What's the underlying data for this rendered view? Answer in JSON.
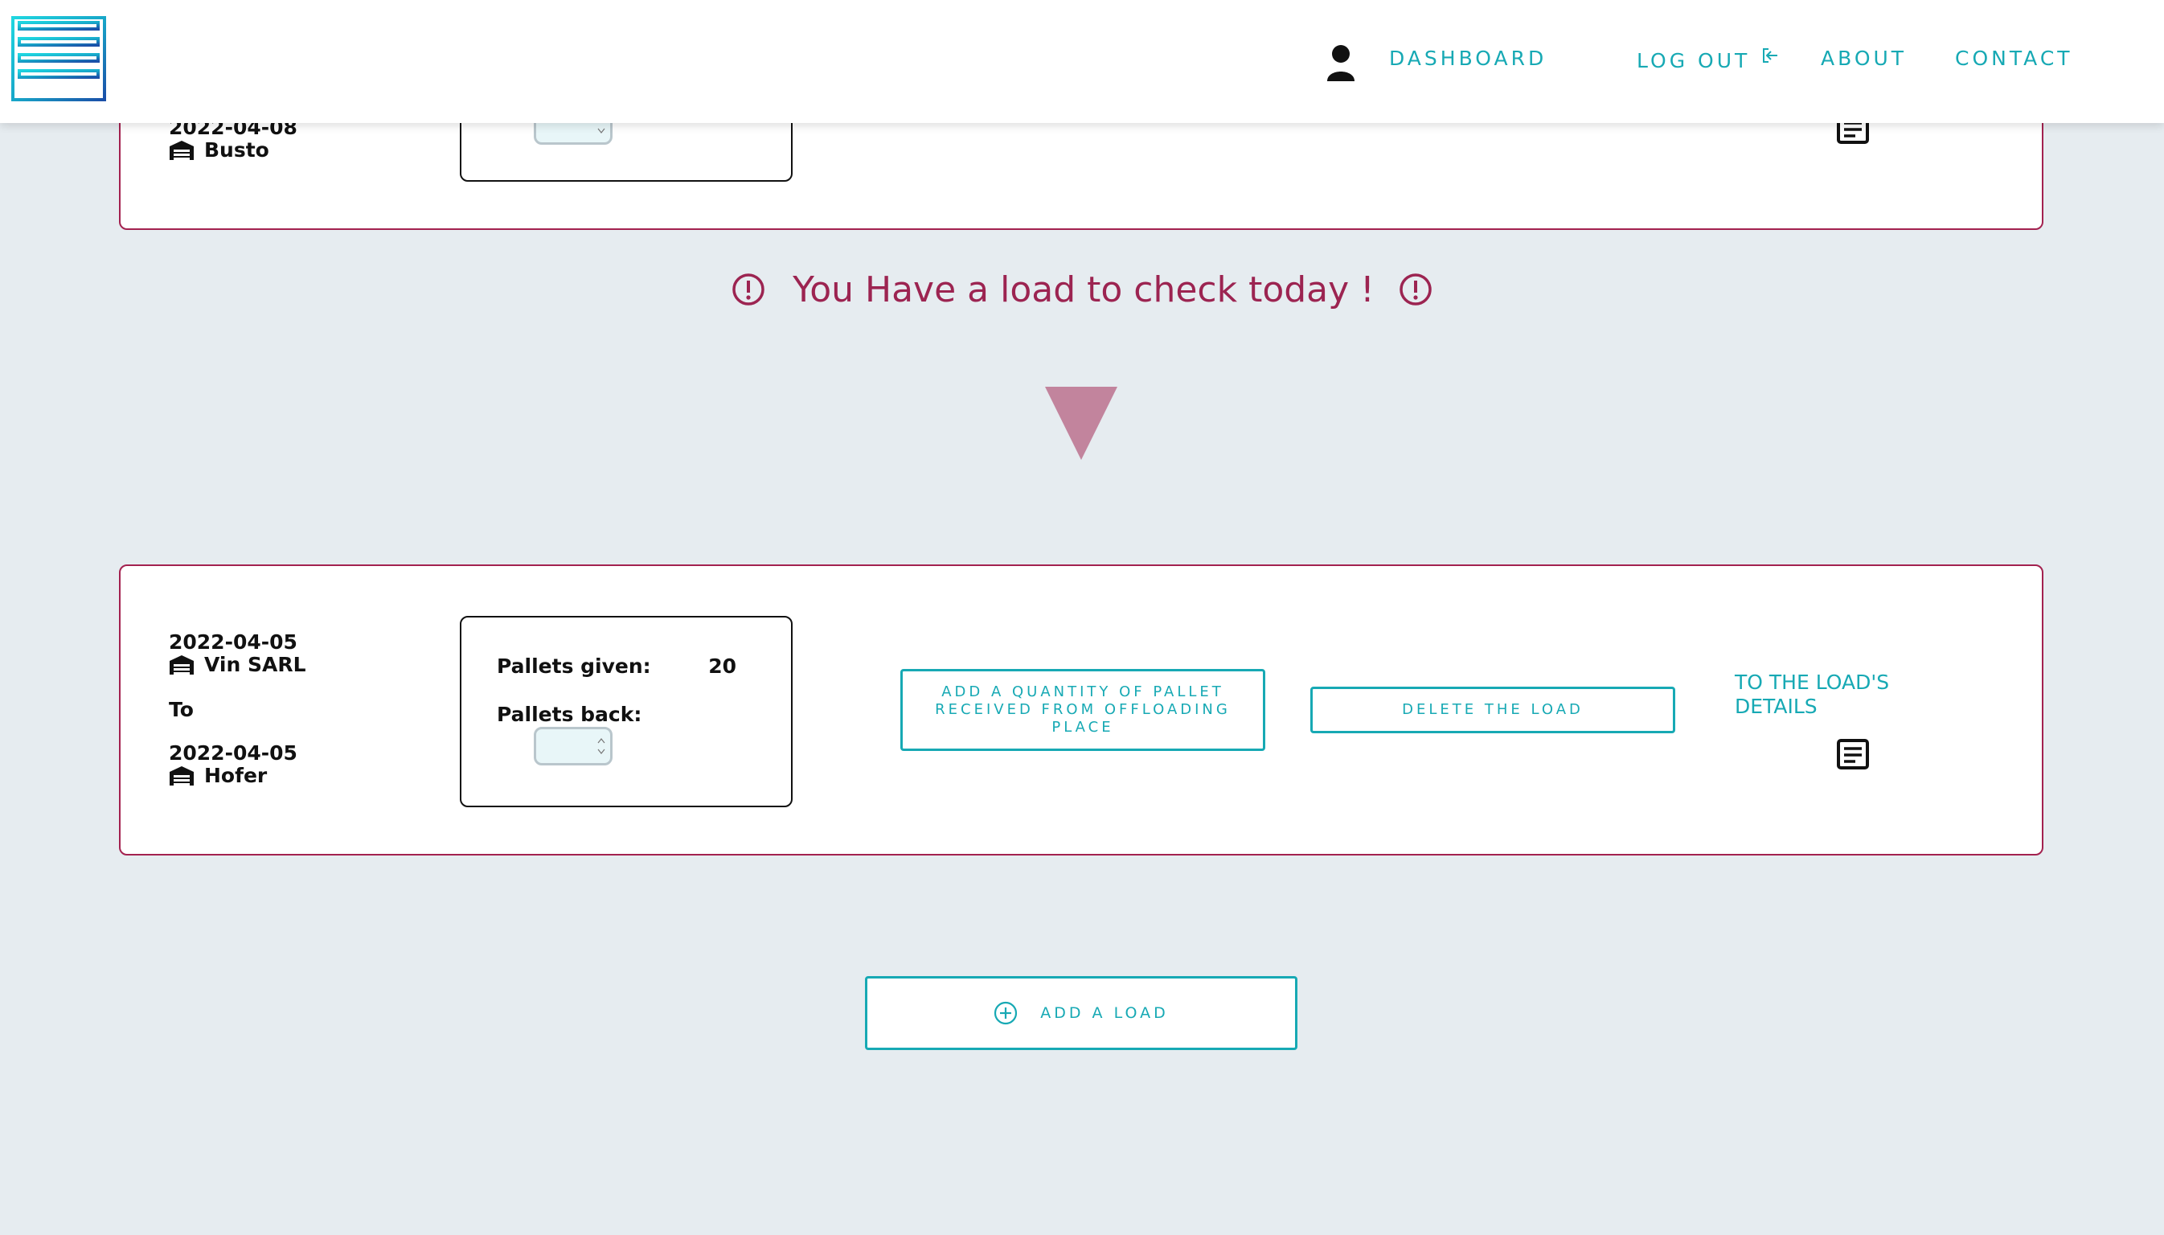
{
  "header": {
    "nav": {
      "dashboard": "DASHBOARD",
      "logout": "LOG OUT",
      "about": "ABOUT",
      "contact": "CONTACT"
    }
  },
  "previous_load": {
    "to_date": "2022-04-08",
    "to_place": "Busto"
  },
  "alert": {
    "text": "You Have a load to check today !"
  },
  "load": {
    "from_date": "2022-04-05",
    "from_place": "Vin SARL",
    "to_label": "To",
    "to_date": "2022-04-05",
    "to_place": "Hofer",
    "pallets_given_label": "Pallets given:",
    "pallets_given_value": "20",
    "pallets_back_label": "Pallets back:",
    "add_quantity_button": "ADD A QUANTITY OF PALLET RECEIVED FROM OFFLOADING PLACE",
    "delete_button": "DELETE THE LOAD",
    "details_link": "TO THE LOAD'S DETAILS"
  },
  "add_load_button": "ADD A LOAD",
  "colors": {
    "accent": "#17a9b4",
    "alert": "#9c2451",
    "card_border": "#a3214f",
    "background": "#e6ecf0"
  }
}
